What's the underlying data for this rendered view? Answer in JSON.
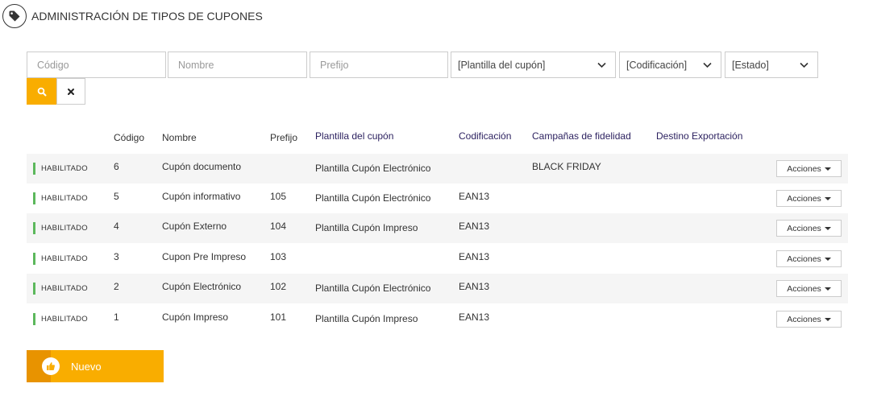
{
  "header": {
    "title": "ADMINISTRACIÓN DE TIPOS DE CUPONES",
    "icon": "tag-icon"
  },
  "filters": {
    "codigo_placeholder": "Código",
    "nombre_placeholder": "Nombre",
    "prefijo_placeholder": "Prefijo",
    "plantilla_selected": "[Plantilla del cupón]",
    "codificacion_selected": "[Codificación]",
    "estado_selected": "[Estado]"
  },
  "columns": {
    "codigo": "Código",
    "nombre": "Nombre",
    "prefijo": "Prefijo",
    "plantilla": "Plantilla del cupón",
    "codificacion": "Codificación",
    "campanas": "Campañas de fidelidad",
    "destino": "Destino Exportación"
  },
  "rows": [
    {
      "status": "HABILITADO",
      "codigo": "6",
      "nombre": "Cupón documento",
      "prefijo": "",
      "plantilla": "Plantilla Cupón Electrónico",
      "codificacion": "",
      "campanas": "BLACK FRIDAY",
      "destino": "",
      "actions": "Acciones"
    },
    {
      "status": "HABILITADO",
      "codigo": "5",
      "nombre": "Cupón informativo",
      "prefijo": "105",
      "plantilla": "Plantilla Cupón Electrónico",
      "codificacion": "EAN13",
      "campanas": "",
      "destino": "",
      "actions": "Acciones"
    },
    {
      "status": "HABILITADO",
      "codigo": "4",
      "nombre": "Cupón Externo",
      "prefijo": "104",
      "plantilla": "Plantilla Cupón Impreso",
      "codificacion": "EAN13",
      "campanas": "",
      "destino": "",
      "actions": "Acciones"
    },
    {
      "status": "HABILITADO",
      "codigo": "3",
      "nombre": "Cupon Pre Impreso",
      "prefijo": "103",
      "plantilla": "",
      "codificacion": "EAN13",
      "campanas": "",
      "destino": "",
      "actions": "Acciones"
    },
    {
      "status": "HABILITADO",
      "codigo": "2",
      "nombre": "Cupón Electrónico",
      "prefijo": "102",
      "plantilla": "Plantilla Cupón Electrónico",
      "codificacion": "EAN13",
      "campanas": "",
      "destino": "",
      "actions": "Acciones"
    },
    {
      "status": "HABILITADO",
      "codigo": "1",
      "nombre": "Cupón Impreso",
      "prefijo": "101",
      "plantilla": "Plantilla Cupón Impreso",
      "codificacion": "EAN13",
      "campanas": "",
      "destino": "",
      "actions": "Acciones"
    }
  ],
  "new_button": {
    "label": "Nuevo",
    "icon": "thumbs-up-icon"
  },
  "colors": {
    "accent": "#f9ad00",
    "accent_dark": "#e89300",
    "status_green": "#5cb85c",
    "header_purple": "#2a1f5e"
  }
}
